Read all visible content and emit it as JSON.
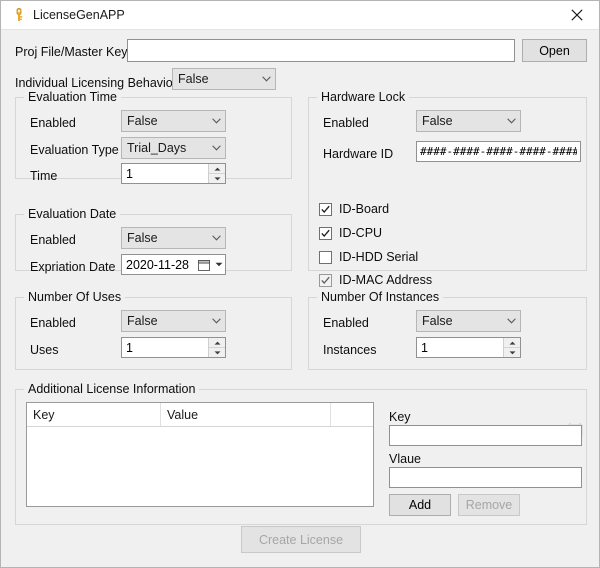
{
  "window": {
    "title": "LicenseGenAPP",
    "icon": "key-icon",
    "close_label": "Close"
  },
  "top": {
    "proj_file_label": "Proj File/Master Key",
    "proj_file_value": "",
    "proj_file_placeholder": "",
    "open_button": "Open",
    "individual_licensing_label": "Individual Licensing Behaviour",
    "individual_licensing_value": "False"
  },
  "evaluation_time": {
    "title": "Evaluation Time",
    "enabled_label": "Enabled",
    "enabled_value": "False",
    "type_label": "Evaluation Type",
    "type_value": "Trial_Days",
    "time_label": "Time",
    "time_value": "1"
  },
  "evaluation_date": {
    "title": "Evaluation Date",
    "enabled_label": "Enabled",
    "enabled_value": "False",
    "expiration_label": "Expriation Date",
    "expiration_value": "2020-11-28"
  },
  "number_of_uses": {
    "title": "Number Of Uses",
    "enabled_label": "Enabled",
    "enabled_value": "False",
    "uses_label": "Uses",
    "uses_value": "1"
  },
  "hardware_lock": {
    "title": "Hardware Lock",
    "enabled_label": "Enabled",
    "enabled_value": "False",
    "hardware_id_label": "Hardware ID",
    "hardware_id_value": "####-####-####-####-####",
    "checkboxes": [
      {
        "label": "ID-Board",
        "checked": true,
        "dim": false
      },
      {
        "label": "ID-CPU",
        "checked": true,
        "dim": false
      },
      {
        "label": "ID-HDD Serial",
        "checked": false,
        "dim": false
      },
      {
        "label": "ID-MAC Address",
        "checked": true,
        "dim": true
      }
    ]
  },
  "number_of_instances": {
    "title": "Number Of Instances",
    "enabled_label": "Enabled",
    "enabled_value": "False",
    "instances_label": "Instances",
    "instances_value": "1"
  },
  "additional_info": {
    "title": "Additional License Information",
    "columns": [
      "Key",
      "Value",
      ""
    ],
    "rows": [],
    "key_label": "Key",
    "key_value": "",
    "value_label": "Vlaue",
    "value_value": "",
    "add_button": "Add",
    "remove_button": "Remove",
    "grid_icon": "table-icon"
  },
  "footer": {
    "create_license_button": "Create License"
  },
  "colors": {
    "window_bg": "#f0f0f0",
    "titlebar_bg": "#ffffff",
    "field_bg": "#ffffff",
    "combo_bg": "#e4e4e4",
    "button_bg": "#e1e1e1",
    "disabled_text": "#a6a6a6",
    "border": "#919191",
    "group_border": "#d6d6d6",
    "icon_gold": "#e8a317"
  }
}
